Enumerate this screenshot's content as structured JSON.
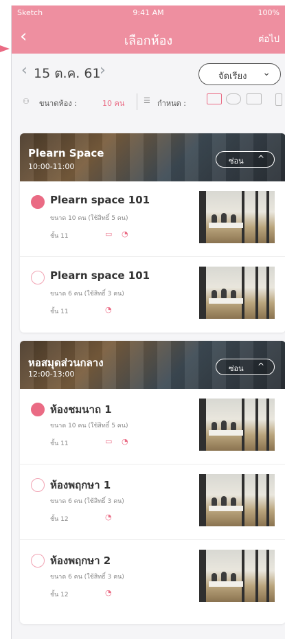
{
  "statusbar": {
    "carrier": "Sketch",
    "time": "9:41 AM",
    "battery": "100%"
  },
  "nav": {
    "back_icon": "chevron-left-icon",
    "title": "เลือกห้อง",
    "next_label": "ต่อไป"
  },
  "datebar": {
    "prev": "‹",
    "date": "15 ต.ค. 61",
    "next": "›",
    "sort_label": "จัดเรียง",
    "sort_chevron": "⌄"
  },
  "filters": {
    "size_label": "ขนาดห้อง :",
    "size_value": "10 คน",
    "settings_label": "กำหนด :",
    "icons": [
      "projector-icon",
      "speech-bubble-icon",
      "monitor-icon",
      "phone-device-icon"
    ]
  },
  "colors": {
    "brand": "#ee8fa0",
    "accent": "#ea6b84"
  },
  "sections": [
    {
      "name": "Plearn Space",
      "time": "10:00-11:00",
      "hide_label": "ซ่อน",
      "hide_chevron": "^",
      "rooms": [
        {
          "name": "Plearn space 101",
          "capacity": "ขนาด 10 คน  (ใช้สิทธิ์ 5 คน)",
          "floor": "ชั้น 11",
          "selected": true
        },
        {
          "name": "Plearn space 101",
          "capacity": "ขนาด 6 คน  (ใช้สิทธิ์ 3 คน)",
          "floor": "ชั้น 11",
          "selected": false
        }
      ]
    },
    {
      "name": "หอสมุดส่วนกลาง",
      "time": "12:00-13:00",
      "hide_label": "ซ่อน",
      "hide_chevron": "^",
      "rooms": [
        {
          "name": "ห้องชมนาถ 1",
          "capacity": "ขนาด 10 คน  (ใช้สิทธิ์ 5 คน)",
          "floor": "ชั้น 11",
          "selected": true
        },
        {
          "name": "ห้องพฤกษา 1",
          "capacity": "ขนาด 6 คน  (ใช้สิทธิ์ 3 คน)",
          "floor": "ชั้น 12",
          "selected": false
        },
        {
          "name": "ห้องพฤกษา 2",
          "capacity": "ขนาด 6 คน  (ใช้สิทธิ์ 3 คน)",
          "floor": "ชั้น 12",
          "selected": false
        }
      ]
    }
  ]
}
